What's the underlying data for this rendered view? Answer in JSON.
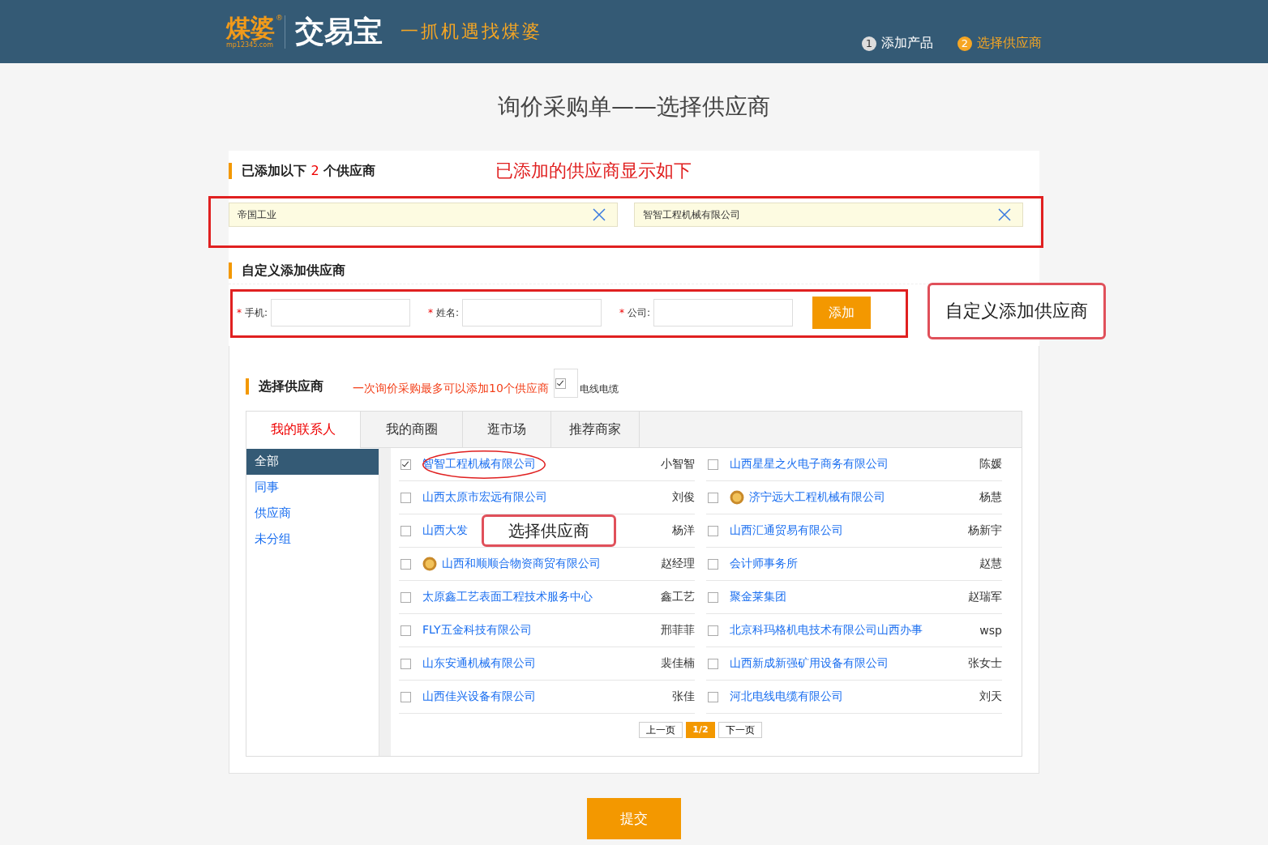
{
  "header": {
    "logo_mark": "煤婆",
    "logo_site": "mp12345.com",
    "logo_reg": "®",
    "brand": "交易宝",
    "slogan": "一抓机遇找煤婆",
    "steps": [
      {
        "num": "1",
        "label": "添加产品",
        "selected": false
      },
      {
        "num": "2",
        "label": "选择供应商",
        "selected": true
      }
    ]
  },
  "title": "询价采购单——选择供应商",
  "added": {
    "prefix": "已添加以下",
    "count": "2",
    "suffix": "个供应商",
    "note": "已添加的供应商显示如下",
    "items": [
      {
        "name": "帝国工业"
      },
      {
        "name": "智智工程机械有限公司"
      }
    ]
  },
  "custom": {
    "heading": "自定义添加供应商",
    "callout": "自定义添加供应商",
    "button": "添加",
    "fields": [
      {
        "star": "*",
        "label": "手机:"
      },
      {
        "star": "*",
        "label": "姓名:"
      },
      {
        "star": "*",
        "label": "公司:"
      }
    ]
  },
  "select": {
    "heading": "选择供应商",
    "note": "一次询价采购最多可以添加10个供应商",
    "callout": "选择供应商",
    "filter": {
      "label": "电线电缆",
      "checked": true
    },
    "tabs": [
      {
        "label": "我的联系人",
        "selected": true
      },
      {
        "label": "我的商圈",
        "selected": false
      },
      {
        "label": "逛市场",
        "selected": false
      },
      {
        "label": "推荐商家",
        "selected": false
      }
    ],
    "groups": [
      {
        "label": "全部",
        "selected": true
      },
      {
        "label": "同事",
        "selected": false
      },
      {
        "label": "供应商",
        "selected": false
      },
      {
        "label": "未分组",
        "selected": false
      }
    ],
    "suppliers": [
      {
        "name": "智智工程机械有限公司",
        "contact": "小智智",
        "checked": true,
        "medal": false
      },
      {
        "name": "山西星星之火电子商务有限公司",
        "contact": "陈媛",
        "checked": false,
        "medal": false
      },
      {
        "name": "山西太原市宏远有限公司",
        "contact": "刘俊",
        "checked": false,
        "medal": false
      },
      {
        "name": "济宁远大工程机械有限公司",
        "contact": "杨慧",
        "checked": false,
        "medal": true
      },
      {
        "name": "山西大发",
        "contact": "杨洋",
        "checked": false,
        "medal": false
      },
      {
        "name": "山西汇通贸易有限公司",
        "contact": "杨新宇",
        "checked": false,
        "medal": false
      },
      {
        "name": "山西和顺顺合物资商贸有限公司",
        "contact": "赵经理",
        "checked": false,
        "medal": true
      },
      {
        "name": "会计师事务所",
        "contact": "赵慧",
        "checked": false,
        "medal": false
      },
      {
        "name": "太原鑫工艺表面工程技术服务中心",
        "contact": "鑫工艺",
        "checked": false,
        "medal": false
      },
      {
        "name": "聚金莱集团",
        "contact": "赵瑞军",
        "checked": false,
        "medal": false
      },
      {
        "name": "FLY五金科技有限公司",
        "contact": "邢菲菲",
        "checked": false,
        "medal": false
      },
      {
        "name": "北京科玛格机电技术有限公司山西办事",
        "contact": "wsp",
        "checked": false,
        "medal": false
      },
      {
        "name": "山东安通机械有限公司",
        "contact": "裴佳楠",
        "checked": false,
        "medal": false
      },
      {
        "name": "山西新成新强矿用设备有限公司",
        "contact": "张女士",
        "checked": false,
        "medal": false
      },
      {
        "name": "山西佳兴设备有限公司",
        "contact": "张佳",
        "checked": false,
        "medal": false
      },
      {
        "name": "河北电线电缆有限公司",
        "contact": "刘天",
        "checked": false,
        "medal": false
      }
    ],
    "pager": {
      "prev": "上一页",
      "page": "1/2",
      "next": "下一页"
    }
  },
  "submit": "提交"
}
